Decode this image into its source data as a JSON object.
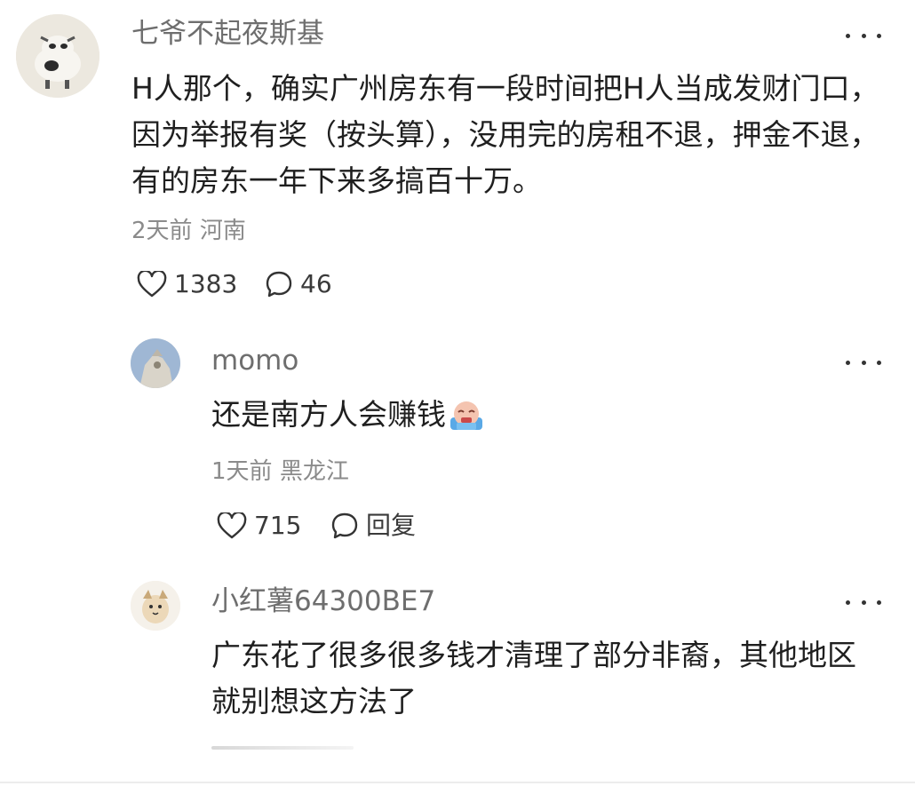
{
  "comment": {
    "username": "七爷不起夜斯基",
    "text": "H人那个，确实广州房东有一段时间把H人当成发财门口，因为举报有奖（按头算），没用完的房租不退，押金不退，有的房东一年下来多搞百十万。",
    "time": "2天前",
    "location": "河南",
    "likes": "1383",
    "replies": "46"
  },
  "replies": [
    {
      "username": "momo",
      "text": "还是南方人会赚钱",
      "emoji": "crying-money-emoji",
      "time": "1天前",
      "location": "黑龙江",
      "likes": "715",
      "reply_label": "回复"
    },
    {
      "username": "小红薯64300BE7",
      "text": "广东花了很多很多钱才清理了部分非裔，其他地区就别想这方法了"
    }
  ],
  "icons": {
    "more": "more-dots-icon",
    "like": "heart-icon",
    "comment": "comment-bubble-icon"
  }
}
